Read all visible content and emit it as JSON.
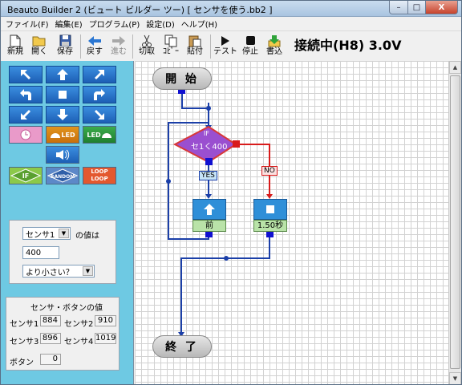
{
  "window": {
    "title": "Beauto Builder 2 (ビュート ビルダー ツー) [ センサを使う.bb2 ]",
    "controls": {
      "minimize": "–",
      "maximize": "□",
      "close": "X"
    }
  },
  "menu": [
    "ファイル(F)",
    "編集(E)",
    "プログラム(P)",
    "設定(D)",
    "ヘルプ(H)"
  ],
  "toolbar": {
    "new": "新規",
    "open": "開く",
    "save": "保存",
    "back": "戻す",
    "forward": "進む",
    "cut": "切取",
    "copy": "ｺﾋﾟｰ",
    "paste": "貼付",
    "test": "テスト",
    "stop": "停止",
    "write": "書込",
    "status": "接続中(H8) 3.0V"
  },
  "palette": {
    "led_label": "LED",
    "if_label": "IF",
    "random_label": "RANDOM",
    "loop_label_top": "LOOP",
    "loop_label_bottom": "LOOP"
  },
  "condition": {
    "sensor_select": "センサ1",
    "value_suffix": "の値は",
    "threshold": "400",
    "comparison_select": "より小さい？"
  },
  "sensor_values": {
    "title": "センサ・ボタンの値",
    "sensor1_label": "センサ1",
    "sensor1_value": "884",
    "sensor2_label": "センサ2",
    "sensor2_value": "910",
    "sensor3_label": "センサ3",
    "sensor3_value": "896",
    "sensor4_label": "センサ4",
    "sensor4_value": "1019",
    "button_label": "ボタン",
    "button_value": "0"
  },
  "flow": {
    "start": "開 始",
    "end": "終 了",
    "if_tag": "IF",
    "if_condition": "セ1く400",
    "yes": "YES",
    "no": "NO",
    "forward_block": "前",
    "wait_block": "1.50秒"
  },
  "colors": {
    "flow_line": "#1b3fa8",
    "no_line": "#d81b1b",
    "if_diamond": "#9a4fd0",
    "block_blue": "#2f8fd8",
    "block_label_bg": "#b9e3a8",
    "palette_bg": "#6ec9e3"
  }
}
